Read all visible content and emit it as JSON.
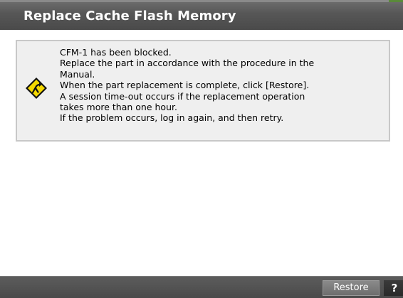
{
  "dialog": {
    "title": "Replace Cache Flash Memory"
  },
  "message": {
    "icon": "warning-diamond-icon",
    "icon_color": "#f5d800",
    "lines": [
      "CFM-1 has been blocked.",
      "Replace the part in accordance with the procedure in the",
      "Manual.",
      "When the part replacement is complete, click [Restore].",
      "A session time-out occurs if the replacement operation",
      "takes more than one hour.",
      "If the problem occurs, log in again, and then retry."
    ]
  },
  "footer": {
    "restore_label": "Restore",
    "help_label": "?"
  }
}
